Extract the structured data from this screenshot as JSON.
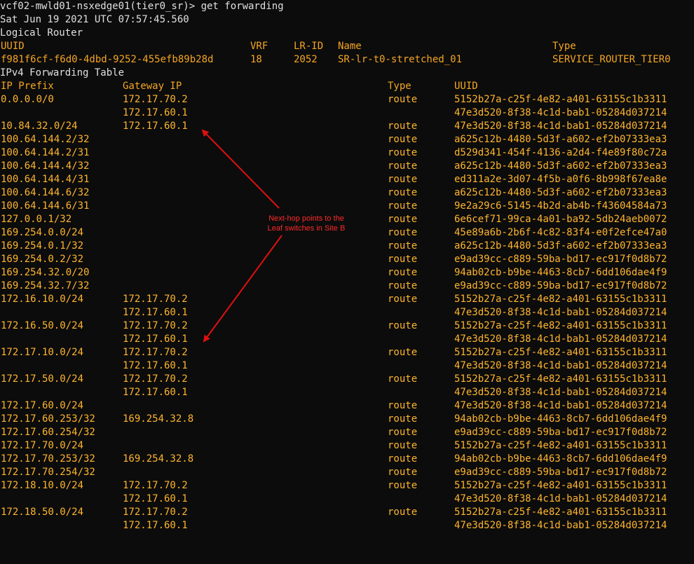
{
  "terminal": {
    "prompt_line": "vcf02-mwld01-nsxedge01(tier0_sr)> get forwarding",
    "timestamp": "Sat Jun 19 2021 UTC 07:57:45.560",
    "section_title": "Logical Router"
  },
  "router_header": {
    "uuid": "UUID",
    "vrf": "VRF",
    "lr_id": "LR-ID",
    "name": "Name",
    "type": "Type"
  },
  "router": {
    "uuid": "f981f6cf-f6d0-4dbd-9252-455efb89b28d",
    "vrf": "18",
    "lr_id": "2052",
    "name": "SR-lr-t0-stretched_01",
    "type": "SERVICE_ROUTER_TIER0"
  },
  "table_title": "IPv4 Forwarding Table",
  "table_header": {
    "prefix": "IP Prefix",
    "gateway": "Gateway IP",
    "type": "Type",
    "uuid": "UUID"
  },
  "rows": [
    {
      "prefix": "0.0.0.0/0",
      "gateway": "172.17.70.2",
      "type": "route",
      "uuid": "5152b27a-c25f-4e82-a401-63155c1b3311"
    },
    {
      "prefix": "",
      "gateway": "172.17.60.1",
      "type": "",
      "uuid": "47e3d520-8f38-4c1d-bab1-05284d037214"
    },
    {
      "prefix": "10.84.32.0/24",
      "gateway": "172.17.60.1",
      "type": "route",
      "uuid": "47e3d520-8f38-4c1d-bab1-05284d037214"
    },
    {
      "prefix": "100.64.144.2/32",
      "gateway": "",
      "type": "route",
      "uuid": "a625c12b-4480-5d3f-a602-ef2b07333ea3"
    },
    {
      "prefix": "100.64.144.2/31",
      "gateway": "",
      "type": "route",
      "uuid": "d529d341-454f-4136-a2d4-f4e89f80c72a"
    },
    {
      "prefix": "100.64.144.4/32",
      "gateway": "",
      "type": "route",
      "uuid": "a625c12b-4480-5d3f-a602-ef2b07333ea3"
    },
    {
      "prefix": "100.64.144.4/31",
      "gateway": "",
      "type": "route",
      "uuid": "ed311a2e-3d07-4f5b-a0f6-8b998f67ea8e"
    },
    {
      "prefix": "100.64.144.6/32",
      "gateway": "",
      "type": "route",
      "uuid": "a625c12b-4480-5d3f-a602-ef2b07333ea3"
    },
    {
      "prefix": "100.64.144.6/31",
      "gateway": "",
      "type": "route",
      "uuid": "9e2a29c6-5145-4b2d-ab4b-f43604584a73"
    },
    {
      "prefix": "127.0.0.1/32",
      "gateway": "",
      "type": "route",
      "uuid": "6e6cef71-99ca-4a01-ba92-5db24aeb0072"
    },
    {
      "prefix": "169.254.0.0/24",
      "gateway": "",
      "type": "route",
      "uuid": "45e89a6b-2b6f-4c82-83f4-e0f2efce47a0"
    },
    {
      "prefix": "169.254.0.1/32",
      "gateway": "",
      "type": "route",
      "uuid": "a625c12b-4480-5d3f-a602-ef2b07333ea3"
    },
    {
      "prefix": "169.254.0.2/32",
      "gateway": "",
      "type": "route",
      "uuid": "e9ad39cc-c889-59ba-bd17-ec917f0d8b72"
    },
    {
      "prefix": "169.254.32.0/20",
      "gateway": "",
      "type": "route",
      "uuid": "94ab02cb-b9be-4463-8cb7-6dd106dae4f9"
    },
    {
      "prefix": "169.254.32.7/32",
      "gateway": "",
      "type": "route",
      "uuid": "e9ad39cc-c889-59ba-bd17-ec917f0d8b72"
    },
    {
      "prefix": "172.16.10.0/24",
      "gateway": "172.17.70.2",
      "type": "route",
      "uuid": "5152b27a-c25f-4e82-a401-63155c1b3311"
    },
    {
      "prefix": "",
      "gateway": "172.17.60.1",
      "type": "",
      "uuid": "47e3d520-8f38-4c1d-bab1-05284d037214"
    },
    {
      "prefix": "172.16.50.0/24",
      "gateway": "172.17.70.2",
      "type": "route",
      "uuid": "5152b27a-c25f-4e82-a401-63155c1b3311"
    },
    {
      "prefix": "",
      "gateway": "172.17.60.1",
      "type": "",
      "uuid": "47e3d520-8f38-4c1d-bab1-05284d037214"
    },
    {
      "prefix": "172.17.10.0/24",
      "gateway": "172.17.70.2",
      "type": "route",
      "uuid": "5152b27a-c25f-4e82-a401-63155c1b3311"
    },
    {
      "prefix": "",
      "gateway": "172.17.60.1",
      "type": "",
      "uuid": "47e3d520-8f38-4c1d-bab1-05284d037214"
    },
    {
      "prefix": "172.17.50.0/24",
      "gateway": "172.17.70.2",
      "type": "route",
      "uuid": "5152b27a-c25f-4e82-a401-63155c1b3311"
    },
    {
      "prefix": "",
      "gateway": "172.17.60.1",
      "type": "",
      "uuid": "47e3d520-8f38-4c1d-bab1-05284d037214"
    },
    {
      "prefix": "172.17.60.0/24",
      "gateway": "",
      "type": "route",
      "uuid": "47e3d520-8f38-4c1d-bab1-05284d037214"
    },
    {
      "prefix": "172.17.60.253/32",
      "gateway": "169.254.32.8",
      "type": "route",
      "uuid": "94ab02cb-b9be-4463-8cb7-6dd106dae4f9"
    },
    {
      "prefix": "172.17.60.254/32",
      "gateway": "",
      "type": "route",
      "uuid": "e9ad39cc-c889-59ba-bd17-ec917f0d8b72"
    },
    {
      "prefix": "172.17.70.0/24",
      "gateway": "",
      "type": "route",
      "uuid": "5152b27a-c25f-4e82-a401-63155c1b3311"
    },
    {
      "prefix": "172.17.70.253/32",
      "gateway": "169.254.32.8",
      "type": "route",
      "uuid": "94ab02cb-b9be-4463-8cb7-6dd106dae4f9"
    },
    {
      "prefix": "172.17.70.254/32",
      "gateway": "",
      "type": "route",
      "uuid": "e9ad39cc-c889-59ba-bd17-ec917f0d8b72"
    },
    {
      "prefix": "172.18.10.0/24",
      "gateway": "172.17.70.2",
      "type": "route",
      "uuid": "5152b27a-c25f-4e82-a401-63155c1b3311"
    },
    {
      "prefix": "",
      "gateway": "172.17.60.1",
      "type": "",
      "uuid": "47e3d520-8f38-4c1d-bab1-05284d037214"
    },
    {
      "prefix": "172.18.50.0/24",
      "gateway": "172.17.70.2",
      "type": "route",
      "uuid": "5152b27a-c25f-4e82-a401-63155c1b3311"
    },
    {
      "prefix": "",
      "gateway": "172.17.60.1",
      "type": "",
      "uuid": "47e3d520-8f38-4c1d-bab1-05284d037214"
    }
  ],
  "annotation": {
    "line1": "Next-hop points to the",
    "line2": "Leaf switches in Site B"
  },
  "colors": {
    "background": "#0c0c0c",
    "text_light": "#e0e0e0",
    "text_amber": "#ffb52e",
    "annotation_red": "#ff2a2a"
  }
}
